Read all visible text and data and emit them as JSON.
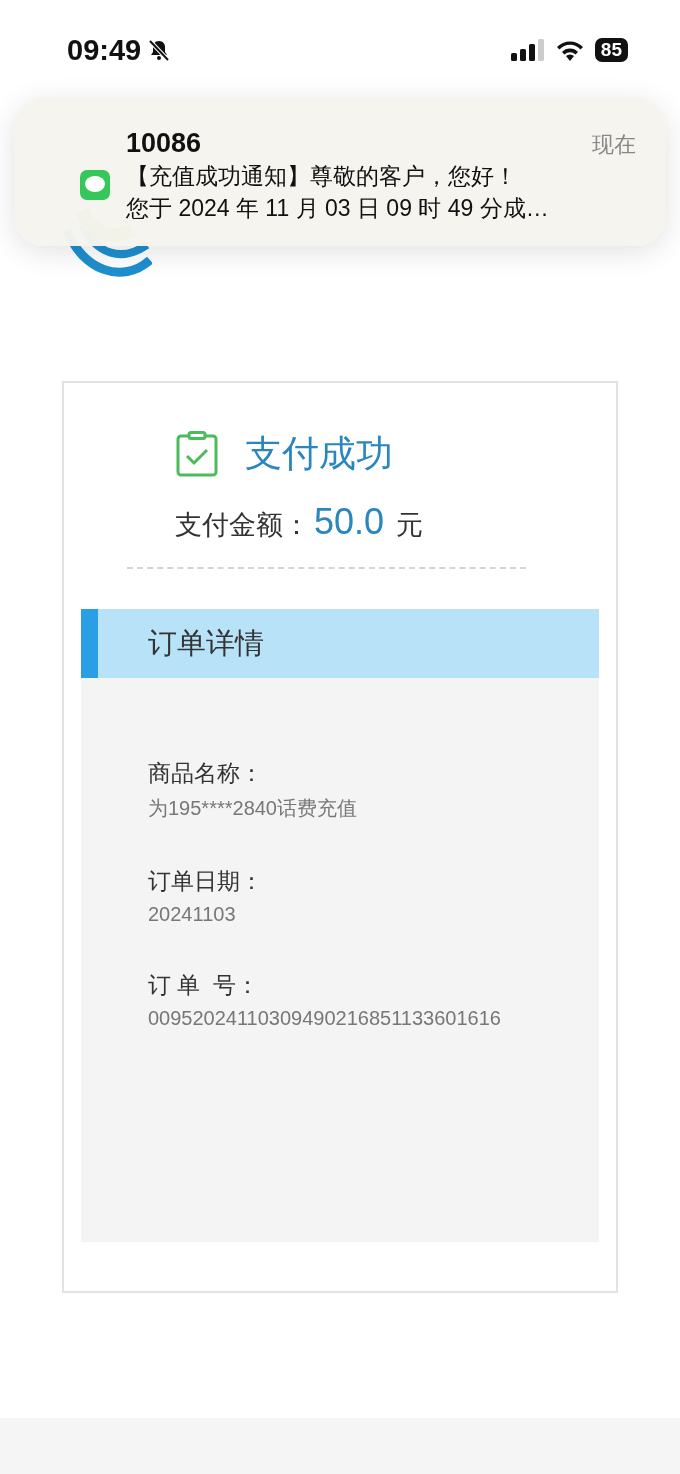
{
  "status_bar": {
    "time": "09:49",
    "battery": "85"
  },
  "notification": {
    "sender": "10086",
    "time": "现在",
    "lines": [
      "【充值成功通知】尊敬的客户，您好！",
      "您于 2024 年 11 月 03 日 09 时 49 分成…"
    ]
  },
  "payment": {
    "title": "支付成功",
    "amount_label": "支付金额：",
    "amount": "50.0",
    "unit": "元"
  },
  "order": {
    "heading": "订单详情",
    "fields": [
      {
        "label": "商品名称：",
        "value": "为195****2840话费充值"
      },
      {
        "label": "订单日期：",
        "value": "20241103"
      },
      {
        "label": "订 单  号：",
        "value": "00952024110309490216851133601616"
      }
    ]
  }
}
